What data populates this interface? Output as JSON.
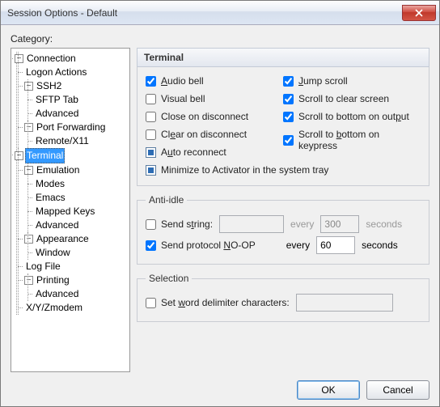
{
  "window": {
    "title": "Session Options - Default"
  },
  "category_label": "Category:",
  "tree": {
    "connection": "Connection",
    "logon_actions": "Logon Actions",
    "ssh2": "SSH2",
    "sftp_tab": "SFTP Tab",
    "advanced": "Advanced",
    "port_forwarding": "Port Forwarding",
    "remote_x11": "Remote/X11",
    "terminal": "Terminal",
    "emulation": "Emulation",
    "modes": "Modes",
    "emacs": "Emacs",
    "mapped_keys": "Mapped Keys",
    "appearance": "Appearance",
    "window": "Window",
    "log_file": "Log File",
    "printing": "Printing",
    "xyz": "X/Y/Zmodem"
  },
  "panel": {
    "title": "Terminal",
    "audio_bell": "Audio bell",
    "visual_bell": "Visual bell",
    "close_disc": "Close on disconnect",
    "clear_disc": "Clear on disconnect",
    "auto_reconnect": "Auto reconnect",
    "minimize_tray": "Minimize to Activator in the system tray",
    "jump_scroll": "Jump scroll",
    "scroll_clear": "Scroll to clear screen",
    "scroll_output": "Scroll to bottom on output",
    "scroll_keypress": "Scroll to bottom on keypress"
  },
  "antiidle": {
    "legend": "Anti-idle",
    "send_string": "Send string:",
    "send_string_value": "",
    "every": "every",
    "seconds": "seconds",
    "string_interval": "300",
    "noop": "Send protocol NO-OP",
    "noop_interval": "60"
  },
  "selection": {
    "legend": "Selection",
    "set_delim": "Set word delimiter characters:",
    "value": ""
  },
  "buttons": {
    "ok": "OK",
    "cancel": "Cancel"
  }
}
